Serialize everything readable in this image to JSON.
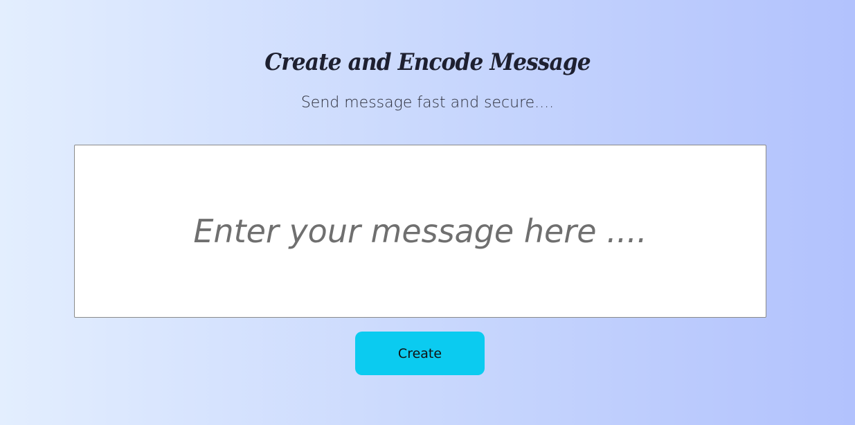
{
  "header": {
    "title": "Create and Encode Message",
    "subtitle": "Send message fast and secure...."
  },
  "form": {
    "message_placeholder": "Enter your message here ....",
    "message_value": "",
    "create_label": "Create"
  },
  "colors": {
    "button_bg": "#0bcbf0",
    "gradient_start": "#e3eefe",
    "gradient_end": "#b2c2fd",
    "title_text": "#1e2030"
  }
}
